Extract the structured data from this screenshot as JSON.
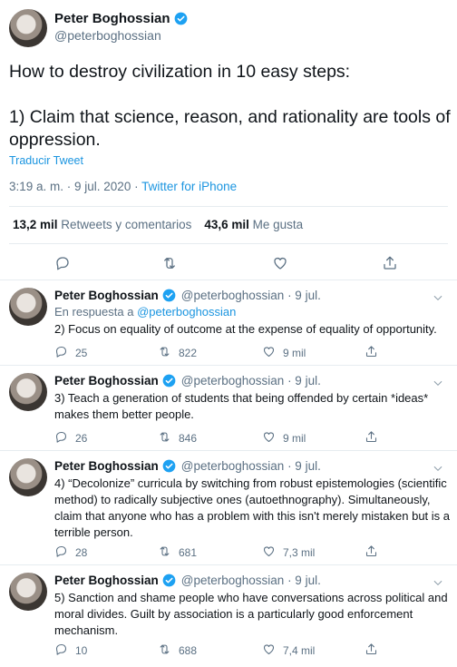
{
  "main": {
    "name": "Peter Boghossian",
    "handle": "@peterboghossian",
    "line1": "How to destroy civilization in 10 easy steps:",
    "line2": "1) Claim that science, reason, and rationality are tools of oppression.",
    "translate": "Traducir Tweet",
    "time": "3:19 a. m. · 9 jul. 2020 · ",
    "source": "Twitter for iPhone",
    "retweets_count": "13,2 mil",
    "retweets_label": "Retweets y comentarios",
    "likes_count": "43,6 mil",
    "likes_label": "Me gusta"
  },
  "replies": [
    {
      "name": "Peter Boghossian",
      "handle": "@peterboghossian · 9 jul.",
      "in_reply_prefix": "En respuesta a ",
      "in_reply_handle": "@peterboghossian",
      "text": "2) Focus on equality of outcome at the expense of equality of opportunity.",
      "replies": "25",
      "retweets": "822",
      "likes": "9 mil"
    },
    {
      "name": "Peter Boghossian",
      "handle": "@peterboghossian · 9 jul.",
      "text": "3) Teach a generation of students that being offended by certain *ideas* makes them better people.",
      "replies": "26",
      "retweets": "846",
      "likes": "9 mil"
    },
    {
      "name": "Peter Boghossian",
      "handle": "@peterboghossian · 9 jul.",
      "text": "4) “Decolonize” curricula by switching from robust epistemologies (scientific method) to radically subjective ones (autoethnography). Simultaneously, claim that anyone who has a problem with this isn't merely mistaken but is a terrible person.",
      "replies": "28",
      "retweets": "681",
      "likes": "7,3 mil"
    },
    {
      "name": "Peter Boghossian",
      "handle": "@peterboghossian · 9 jul.",
      "text": "5) Sanction and shame people who have conversations across political and moral divides. Guilt by association is a particularly good enforcement mechanism.",
      "replies": "10",
      "retweets": "688",
      "likes": "7,4 mil"
    }
  ],
  "colors": {
    "link": "#1b95e0",
    "muted": "#5b7083",
    "border": "#e6ecf0"
  },
  "icons": [
    "verified-badge-icon",
    "reply-icon",
    "retweet-icon",
    "like-icon",
    "share-icon",
    "chevron-down-icon"
  ]
}
